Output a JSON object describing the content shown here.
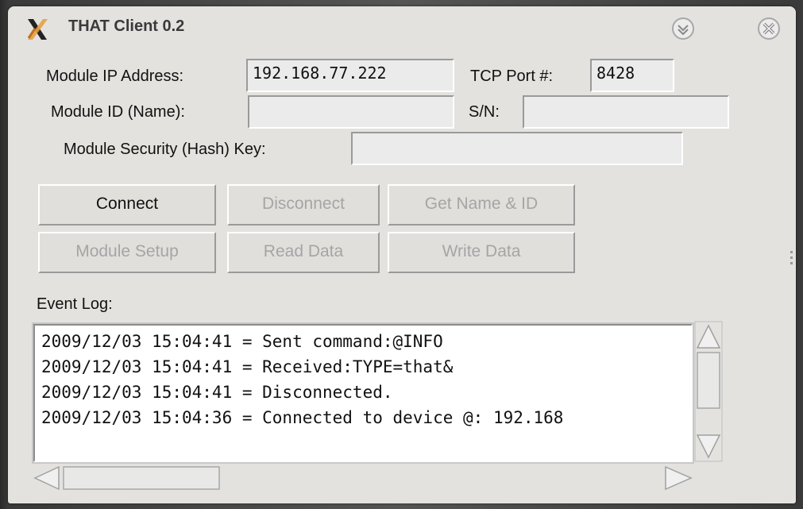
{
  "window": {
    "title": "THAT Client 0.2"
  },
  "form": {
    "ip_label": "Module IP Address:",
    "ip_value": "192.168.77.222",
    "port_label": "TCP Port #:",
    "port_value": "8428",
    "id_label": "Module ID (Name):",
    "id_value": "",
    "sn_label": "S/N:",
    "sn_value": "",
    "hash_label": "Module Security (Hash) Key:",
    "hash_value": ""
  },
  "buttons": {
    "connect": "Connect",
    "disconnect": "Disconnect",
    "get_name_id": "Get Name & ID",
    "module_setup": "Module Setup",
    "read_data": "Read Data",
    "write_data": "Write Data"
  },
  "event_log": {
    "label": "Event Log:",
    "lines": [
      "2009/12/03 15:04:41 = Sent command:@INFO",
      "2009/12/03 15:04:41 = Received:TYPE=that&",
      "2009/12/03 15:04:41 = Disconnected.",
      "2009/12/03 15:04:36 = Connected to device @: 192.168"
    ]
  },
  "icons": {
    "app": "x-app-icon",
    "shade": "chevron-down-icon",
    "close": "close-icon"
  },
  "colors": {
    "window_bg": "#e3e2df",
    "disabled_text": "#a5a5a5"
  }
}
